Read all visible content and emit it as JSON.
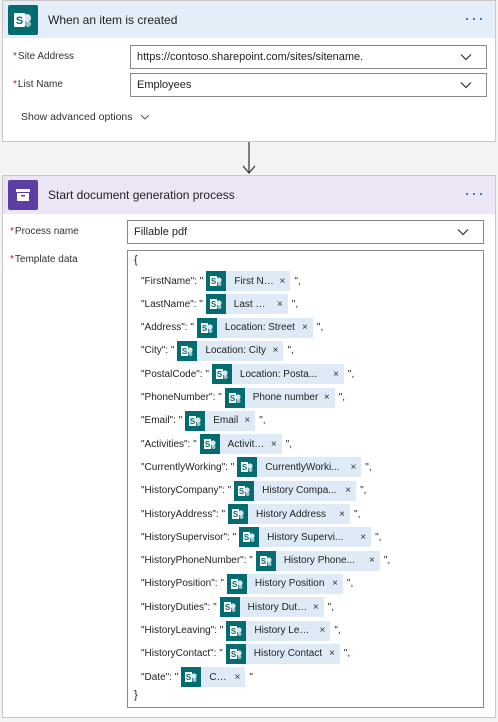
{
  "trigger": {
    "title": "When an item is created",
    "site_address_label": "Site Address",
    "site_address_value": "https://contoso.sharepoint.com/sites/sitename.",
    "list_name_label": "List Name",
    "list_name_value": "Employees",
    "advanced_options": "Show advanced options",
    "required_mark": "*",
    "more_menu": "···"
  },
  "action": {
    "title": "Start document generation process",
    "process_name_label": "Process name",
    "process_name_value": "Fillable pdf",
    "template_data_label": "Template data",
    "required_mark": "*",
    "more_menu": "···",
    "open_brace": "{",
    "close_brace": "}",
    "lines": [
      {
        "key": "\"FirstName\": \"",
        "token": "First Name",
        "suffix": "\","
      },
      {
        "key": "\"LastName\": \"",
        "token": "Last Name",
        "suffix": "\","
      },
      {
        "key": "\"Address\": \"",
        "token": "Location: Street",
        "suffix": "\","
      },
      {
        "key": "\"City\": \"",
        "token": "Location: City",
        "suffix": "\","
      },
      {
        "key": "\"PostalCode\": \"",
        "token": "Location: Posta...",
        "suffix": "\","
      },
      {
        "key": "\"PhoneNumber\": \"",
        "token": "Phone number",
        "suffix": "\","
      },
      {
        "key": "\"Email\": \"",
        "token": "Email",
        "suffix": "\","
      },
      {
        "key": "\"Activities\": \"",
        "token": "Activities",
        "suffix": "\","
      },
      {
        "key": "\"CurrentlyWorking\": \"",
        "token": "CurrentlyWorki...",
        "suffix": "\","
      },
      {
        "key": "\"HistoryCompany\": \"",
        "token": "History Compa...",
        "suffix": "\","
      },
      {
        "key": "\"HistoryAddress\": \"",
        "token": "History Address",
        "suffix": "\","
      },
      {
        "key": "\"HistorySupervisor\": \"",
        "token": "History Supervi...",
        "suffix": "\","
      },
      {
        "key": "\"HistoryPhoneNumber\": \"",
        "token": "History Phone...",
        "suffix": "\","
      },
      {
        "key": "\"HistoryPosition\": \"",
        "token": "History Position",
        "suffix": "\","
      },
      {
        "key": "\"HistoryDuties\": \"",
        "token": "History Duties",
        "suffix": "\","
      },
      {
        "key": "\"HistoryLeaving\": \"",
        "token": "History Leaving",
        "suffix": "\","
      },
      {
        "key": "\"HistoryContact\": \"",
        "token": "History Contact",
        "suffix": "\","
      },
      {
        "key": "\"Date\": \"",
        "token": "Created",
        "suffix": "\""
      }
    ]
  },
  "icons": {
    "trigger_app": "sharepoint-icon",
    "action_app": "document-archive-icon",
    "token_app": "sharepoint-icon",
    "dropdown": "chevron-down-icon",
    "connector": "arrow-down-icon",
    "token_remove": "close-icon",
    "token_remove_glyph": "×"
  },
  "colors": {
    "trigger_header": "#e3eef8",
    "action_header": "#ebe5f6",
    "sharepoint": "#036c70",
    "action_icon": "#5c3fa3",
    "token_bg": "#deeaf6",
    "required": "#a4262c",
    "menu_dots": "#2c6cb6"
  }
}
